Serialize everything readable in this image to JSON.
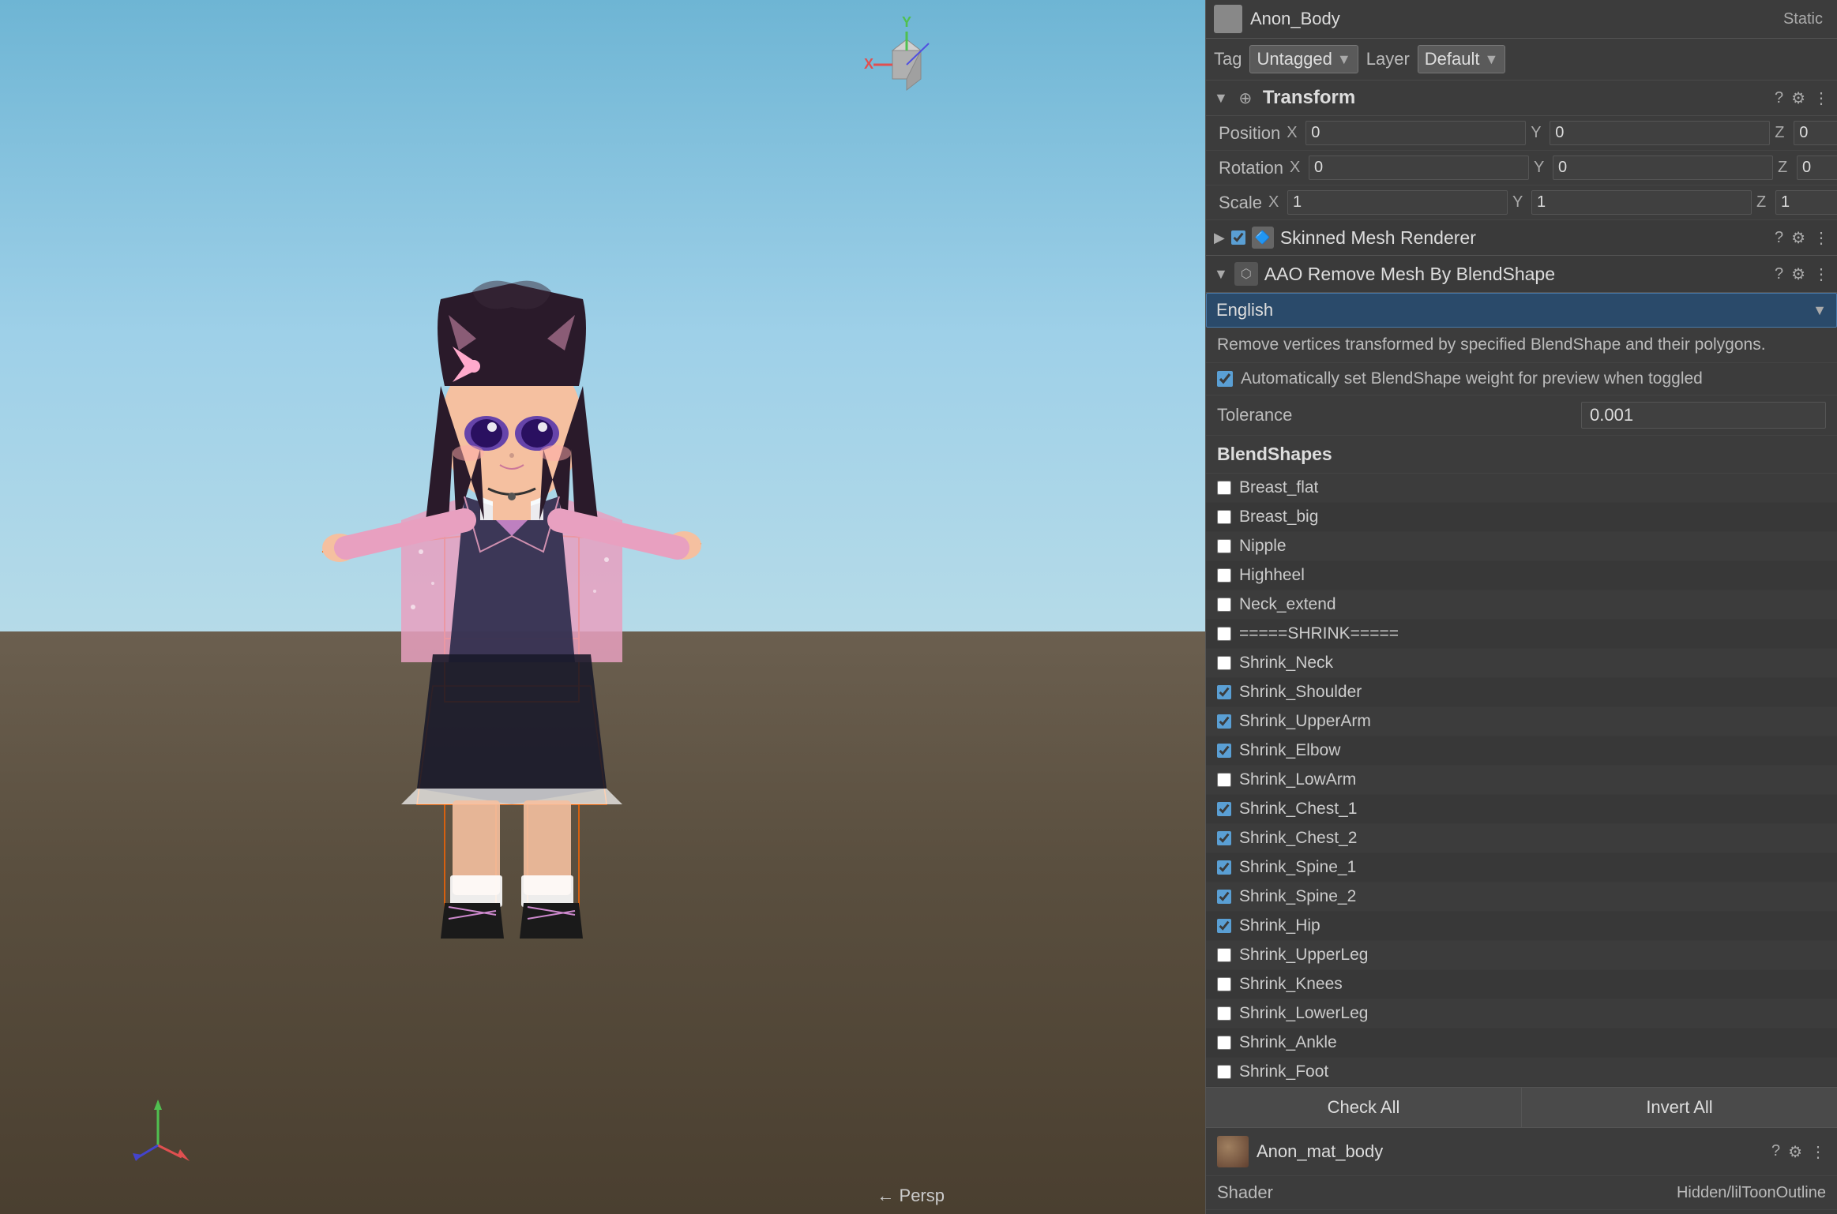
{
  "header": {
    "name": "Anon_Body",
    "static": "Static",
    "tag_label": "Tag",
    "tag_value": "Untagged",
    "layer_label": "Layer",
    "layer_value": "Default"
  },
  "transform": {
    "section_title": "Transform",
    "position_label": "Position",
    "position": {
      "x": "0",
      "y": "0",
      "z": "0"
    },
    "rotation_label": "Rotation",
    "rotation": {
      "x": "0",
      "y": "0",
      "z": "0"
    },
    "scale_label": "Scale",
    "scale": {
      "x": "1",
      "y": "1",
      "z": "1"
    }
  },
  "skinned_mesh": {
    "title": "Skinned Mesh Renderer"
  },
  "aao": {
    "title": "AAO Remove Mesh By BlendShape",
    "language": "English",
    "description": "Remove vertices transformed by specified BlendShape and their polygons.",
    "auto_blend_label": "Automatically set BlendShape weight for preview when toggled",
    "tolerance_label": "Tolerance",
    "tolerance_value": "0.001"
  },
  "blendshapes": {
    "header": "BlendShapes",
    "items": [
      {
        "label": "Breast_flat",
        "checked": false
      },
      {
        "label": "Breast_big",
        "checked": false
      },
      {
        "label": "Nipple",
        "checked": false
      },
      {
        "label": "Highheel",
        "checked": false
      },
      {
        "label": "Neck_extend",
        "checked": false
      },
      {
        "label": "=====SHRINK=====",
        "checked": false
      },
      {
        "label": "Shrink_Neck",
        "checked": false
      },
      {
        "label": "Shrink_Shoulder",
        "checked": true
      },
      {
        "label": "Shrink_UpperArm",
        "checked": true
      },
      {
        "label": "Shrink_Elbow",
        "checked": true
      },
      {
        "label": "Shrink_LowArm",
        "checked": false
      },
      {
        "label": "Shrink_Chest_1",
        "checked": true
      },
      {
        "label": "Shrink_Chest_2",
        "checked": true
      },
      {
        "label": "Shrink_Spine_1",
        "checked": true
      },
      {
        "label": "Shrink_Spine_2",
        "checked": true
      },
      {
        "label": "Shrink_Hip",
        "checked": true
      },
      {
        "label": "Shrink_UpperLeg",
        "checked": false
      },
      {
        "label": "Shrink_Knees",
        "checked": false
      },
      {
        "label": "Shrink_LowerLeg",
        "checked": false
      },
      {
        "label": "Shrink_Ankle",
        "checked": false
      },
      {
        "label": "Shrink_Foot",
        "checked": false
      }
    ]
  },
  "buttons": {
    "check_all": "Check All",
    "invert_all": "Invert All"
  },
  "material": {
    "name": "Anon_mat_body",
    "shader_label": "Shader",
    "shader_value": "Hidden/lilToonOutline"
  },
  "viewport": {
    "persp_label": "← Persp"
  }
}
